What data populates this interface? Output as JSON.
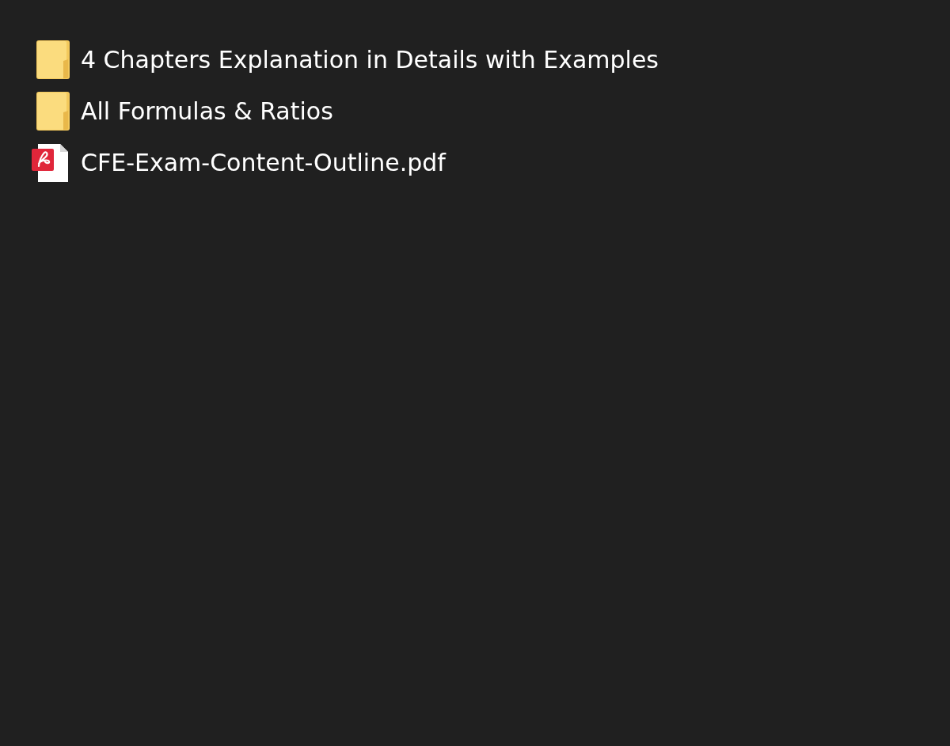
{
  "files": [
    {
      "kind": "folder",
      "name": "4 Chapters Explanation in Details with Examples"
    },
    {
      "kind": "folder",
      "name": "All Formulas & Ratios"
    },
    {
      "kind": "pdf",
      "name": "CFE-Exam-Content-Outline.pdf"
    }
  ]
}
